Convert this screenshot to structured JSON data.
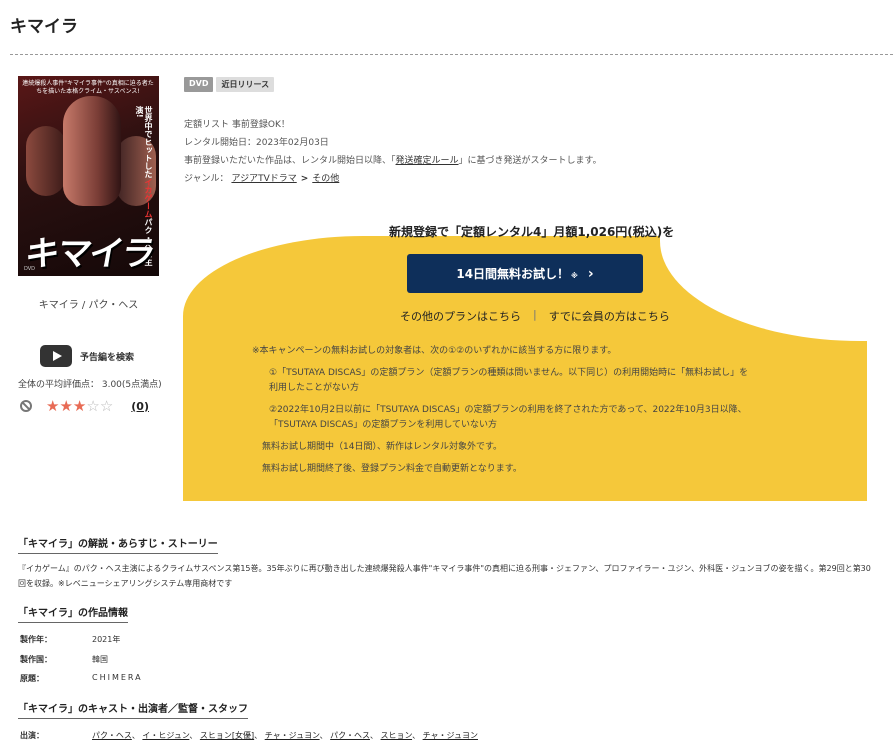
{
  "page": {
    "title": "キマイラ"
  },
  "product": {
    "poster": {
      "blurb": "連続爆殺人事件\"キマイラ事件\"の真相に迫る者たちを描いた本格クライム・サスペンス!",
      "side_text_1": "世界中でヒットした",
      "side_text_2": "イカゲーム",
      "side_text_3": "パク・ヘス主演!",
      "logo": "キマイラ",
      "dvd_mark": "DVD"
    },
    "caption": "キマイラ / パク・ヘス",
    "trailer_label": "予告編を検索",
    "rating_label": "全体の平均評価点： 3.00(5点満点)",
    "rating_value": 3,
    "rating_max": 5,
    "stars": [
      "★",
      "★",
      "★",
      "☆",
      "☆"
    ],
    "review_count": "(0)"
  },
  "badges": [
    "DVD",
    "近日リリース"
  ],
  "meta": {
    "line1": "定額リスト 事前登録OK！",
    "line2": "レンタル開始日：2023年02月03日",
    "line3_pre": "事前登録いただいた作品は、レンタル開始日以降、「",
    "line3_link": "発送確定ルール",
    "line3_post": "」に基づき発送がスタートします。",
    "genre_label": "ジャンル：",
    "genre_1": "アジアTVドラマ",
    "genre_chev": ">",
    "genre_2": "その他"
  },
  "promo": {
    "headline": "新規登録で「定額レンタル4」月額1,026円(税込)を",
    "button_label": "14日間無料お試し！",
    "button_mark": "※",
    "button_arrow": "›",
    "other_plans": "その他のプランはこちら",
    "separator": "|",
    "members": "すでに会員の方はこちら",
    "notes": [
      "※本キャンペーンの無料お試しの対象者は、次の①②のいずれかに該当する方に限ります。",
      "①「TSUTAYA DISCAS」の定額プラン（定額プランの種類は問いません。以下同じ）の利用開始時に「無料お試し」を",
      "利用したことがない方",
      "②2022年10月2日以前に「TSUTAYA DISCAS」の定額プランの利用を終了された方であって、2022年10月3日以降、",
      "「TSUTAYA DISCAS」の定額プランを利用していない方",
      "無料お試し期間中（14日間）、新作はレンタル対象外です。",
      "無料お試し期間終了後、登録プラン料金で自動更新となります。"
    ]
  },
  "story": {
    "heading": "「キマイラ」の解説・あらすじ・ストーリー",
    "text": "『イカゲーム』のパク・ヘス主演によるクライムサスペンス第15巻。35年ぶりに再び動き出した連続爆発殺人事件\"キマイラ事件\"の真相に迫る刑事・ジェファン、プロファイラー・ユジン、外科医・ジュンヨブの姿を描く。第29回と第30回を収録。※レベニューシェアリングシステム専用商材です"
  },
  "info": {
    "heading": "「キマイラ」の作品情報",
    "rows": [
      {
        "label": "製作年：",
        "value": "2021年"
      },
      {
        "label": "製作国：",
        "value": "韓国"
      },
      {
        "label": "原題：",
        "value": "CHIMERA"
      }
    ]
  },
  "cast": {
    "heading": "「キマイラ」のキャスト・出演者／監督・スタッフ",
    "label": "出演：",
    "names": [
      "パク・ヘス",
      "イ・ヒジュン",
      "スヒョン[女優]",
      "チャ・ジュヨン",
      "パク・ヘス",
      "スヒョン",
      "チャ・ジュヨン"
    ]
  },
  "colors": {
    "promo_bg": "#f5c83a",
    "button_bg": "#0e2f5a",
    "star_on": "#e86b55"
  }
}
